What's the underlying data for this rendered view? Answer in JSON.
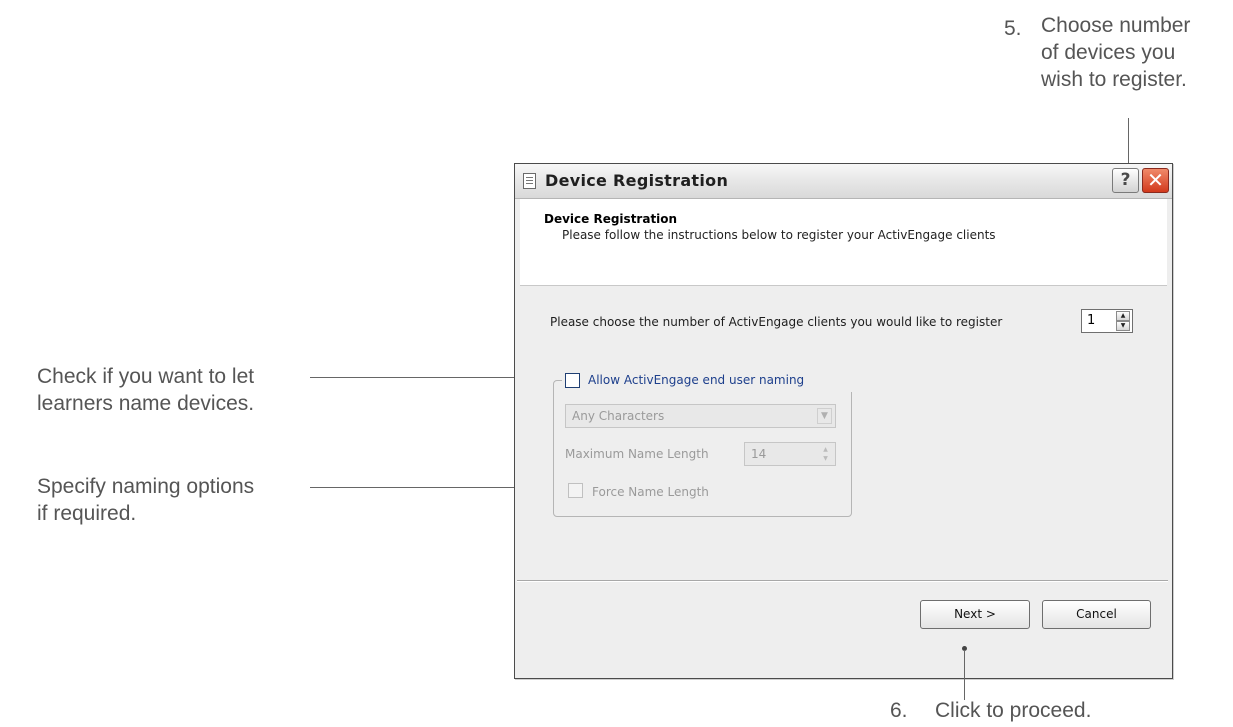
{
  "annotations": {
    "step5": {
      "number": "5.",
      "lines": [
        "Choose number",
        "of devices you",
        "wish to register."
      ]
    },
    "step6": {
      "number": "6.",
      "text": "Click to proceed."
    },
    "naming_check": {
      "lines": [
        "Check if you want to let",
        "learners name devices."
      ]
    },
    "naming_options": {
      "lines": [
        "Specify naming options",
        "if required."
      ]
    }
  },
  "dialog": {
    "title": "Device Registration",
    "help_label": "?",
    "close_label": "✕",
    "header": {
      "title": "Device Registration",
      "subtitle": "Please follow the instructions below to register your ActivEngage clients"
    },
    "client_count": {
      "label": "Please choose the number of ActivEngage clients you would like to register",
      "value": "1"
    },
    "naming": {
      "checkbox_label": "Allow ActivEngage end user naming",
      "checked": false,
      "character_mode": "Any Characters",
      "max_length_label": "Maximum Name Length",
      "max_length_value": "14",
      "force_length_label": "Force Name Length"
    },
    "buttons": {
      "next": "Next >",
      "cancel": "Cancel"
    }
  },
  "colors": {
    "annotation_text": "#555555",
    "group_label": "#1d3f8c",
    "close_button": "#d2391c",
    "disabled_text": "#9a9a9a"
  }
}
